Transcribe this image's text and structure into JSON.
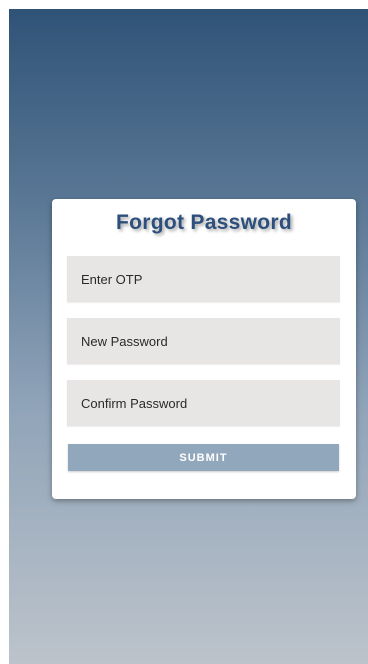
{
  "form": {
    "title": "Forgot Password",
    "otp_placeholder": "Enter OTP",
    "new_password_placeholder": "New Password",
    "confirm_password_placeholder": "Confirm Password",
    "submit_label": "SUBMIT"
  },
  "colors": {
    "title": "#2d4f7c",
    "background_top": "#2f5377",
    "background_bottom": "#bcc3cb",
    "field_background": "#e7e6e5",
    "submit_background": "#91a7bb"
  }
}
